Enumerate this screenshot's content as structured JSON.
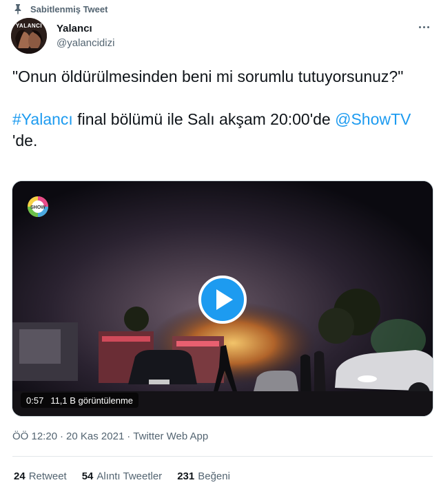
{
  "pinned": {
    "label": "Sabitlenmiş Tweet",
    "icon": "pin-icon"
  },
  "author": {
    "name": "Yalancı",
    "handle": "@yalancidizi",
    "avatar_text": "YALANCI"
  },
  "tweet": {
    "line1": "\"Onun öldürülmesinden beni mi sorumlu tutuyorsunuz?\"",
    "hashtag": "#Yalancı",
    "middle": " final bölümü ile Salı akşam 20:00'de ",
    "mention": "@ShowTV",
    "tail": "'de."
  },
  "media": {
    "duration": "0:57",
    "views": "11,1 B görüntülenme",
    "channel_logo_text": "SHOW"
  },
  "meta": {
    "time": "ÖÖ 12:20",
    "date": "20 Kas 2021",
    "source": "Twitter Web App",
    "separator": "·"
  },
  "stats": {
    "retweet_count": "24",
    "retweet_label": "Retweet",
    "quote_count": "54",
    "quote_label": "Alıntı Tweetler",
    "like_count": "231",
    "like_label": "Beğeni"
  },
  "colors": {
    "accent": "#1d9bf0",
    "text": "#0f1419",
    "secondary": "#536471"
  }
}
